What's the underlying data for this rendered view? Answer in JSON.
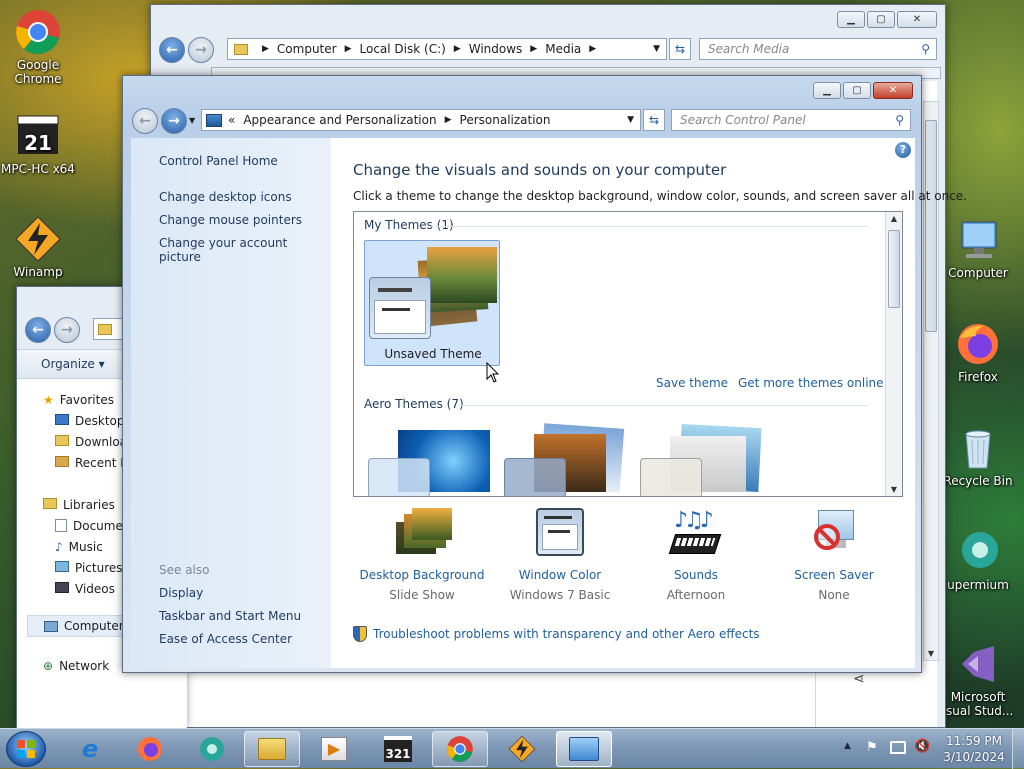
{
  "desktop": {
    "icons_left": [
      {
        "label": "Google Chrome",
        "icon": "chrome-icon"
      },
      {
        "label": "MPC-HC x64",
        "icon": "mpc-hc-icon"
      },
      {
        "label": "Winamp",
        "icon": "winamp-icon"
      }
    ],
    "icons_right": [
      {
        "label": "Computer",
        "icon": "computer-icon"
      },
      {
        "label": "Firefox",
        "icon": "firefox-icon"
      },
      {
        "label": "Recycle Bin",
        "icon": "recycle-bin-icon"
      },
      {
        "label": "upermium",
        "icon": "supermium-icon"
      },
      {
        "label": "Microsoft",
        "label2": "isual Stud...",
        "icon": "visual-studio-icon"
      }
    ]
  },
  "media_window": {
    "breadcrumb": [
      "Computer",
      "Local Disk (C:)",
      "Windows",
      "Media"
    ],
    "search_placeholder": "Search Media"
  },
  "explorer_window": {
    "organize_label": "Organize",
    "favorites_label": "Favorites",
    "favorites": [
      "Desktop",
      "Downloa",
      "Recent Pl"
    ],
    "libraries_label": "Libraries",
    "libraries": [
      "Documen",
      "Music",
      "Pictures",
      "Videos"
    ],
    "computer_label": "Computer",
    "network_label": "Network"
  },
  "cp_window": {
    "breadcrumb_prefix": "«",
    "breadcrumb": [
      "Appearance and Personalization",
      "Personalization"
    ],
    "search_placeholder": "Search Control Panel",
    "sidebar": {
      "home": "Control Panel Home",
      "links": [
        "Change desktop icons",
        "Change mouse pointers",
        "Change your account picture"
      ],
      "see_also_label": "See also",
      "see_also": [
        "Display",
        "Taskbar and Start Menu",
        "Ease of Access Center"
      ]
    },
    "main": {
      "title": "Change the visuals and sounds on your computer",
      "subtitle": "Click a theme to change the desktop background, window color, sounds, and screen saver all at once.",
      "my_themes_label": "My Themes (1)",
      "unsaved_theme_label": "Unsaved Theme",
      "save_theme": "Save theme",
      "get_more_themes": "Get more themes online",
      "aero_themes_label": "Aero Themes (7)",
      "settings": [
        {
          "label": "Desktop Background",
          "value": "Slide Show",
          "icon": "desktop-background-icon"
        },
        {
          "label": "Window Color",
          "value": "Windows 7 Basic",
          "icon": "window-color-icon"
        },
        {
          "label": "Sounds",
          "value": "Afternoon",
          "icon": "sounds-icon"
        },
        {
          "label": "Screen Saver",
          "value": "None",
          "icon": "screen-saver-icon"
        }
      ],
      "troubleshoot": "Troubleshoot problems with transparency and other Aero effects"
    }
  },
  "taskbar": {
    "time": "11:59 PM",
    "date": "3/10/2024"
  }
}
